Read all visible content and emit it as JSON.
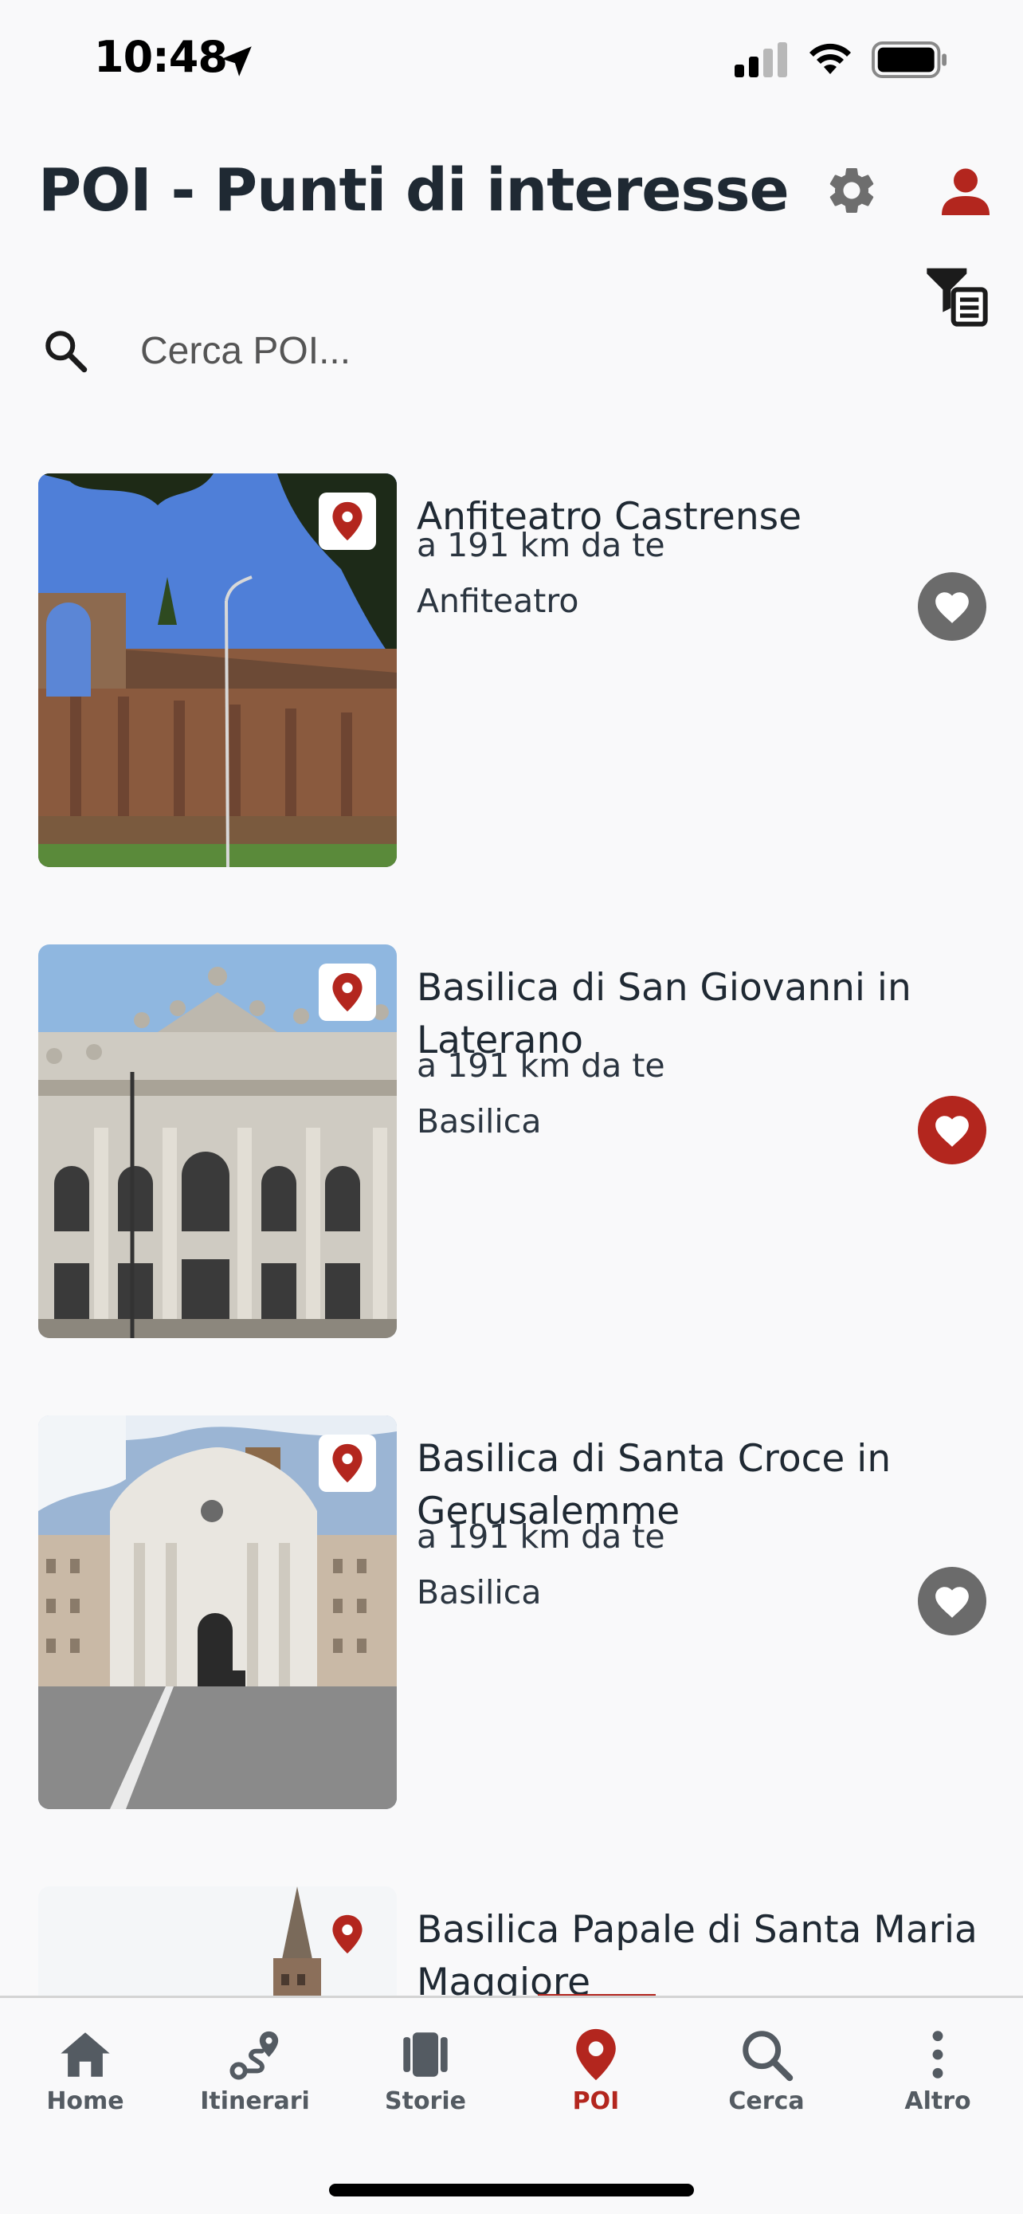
{
  "status_bar": {
    "time": "10:48"
  },
  "header": {
    "title": "POI - Punti di interesse"
  },
  "search": {
    "placeholder": "Cerca POI..."
  },
  "colors": {
    "accent": "#b3261e",
    "muted_icon": "#6b6b6b",
    "fav_inactive": "#6b6b6b"
  },
  "pois": [
    {
      "name": "Anfiteatro Castrense",
      "distance": "a 191 km da te",
      "category": "Anfiteatro",
      "favorite": false
    },
    {
      "name": "Basilica di San Giovanni in Laterano",
      "distance": "a 191 km da te",
      "category": "Basilica",
      "favorite": true
    },
    {
      "name": "Basilica di Santa Croce in Gerusalemme",
      "distance": "a 191 km da te",
      "category": "Basilica",
      "favorite": false
    },
    {
      "name": "Basilica Papale di Santa Maria Maggiore",
      "distance": "",
      "category": "",
      "favorite": false
    }
  ],
  "tabs": [
    {
      "label": "Home",
      "icon": "home-icon",
      "active": false
    },
    {
      "label": "Itinerari",
      "icon": "route-icon",
      "active": false
    },
    {
      "label": "Storie",
      "icon": "stories-icon",
      "active": false
    },
    {
      "label": "POI",
      "icon": "map-pin-icon",
      "active": true
    },
    {
      "label": "Cerca",
      "icon": "search-icon",
      "active": false
    },
    {
      "label": "Altro",
      "icon": "more-icon",
      "active": false
    }
  ]
}
